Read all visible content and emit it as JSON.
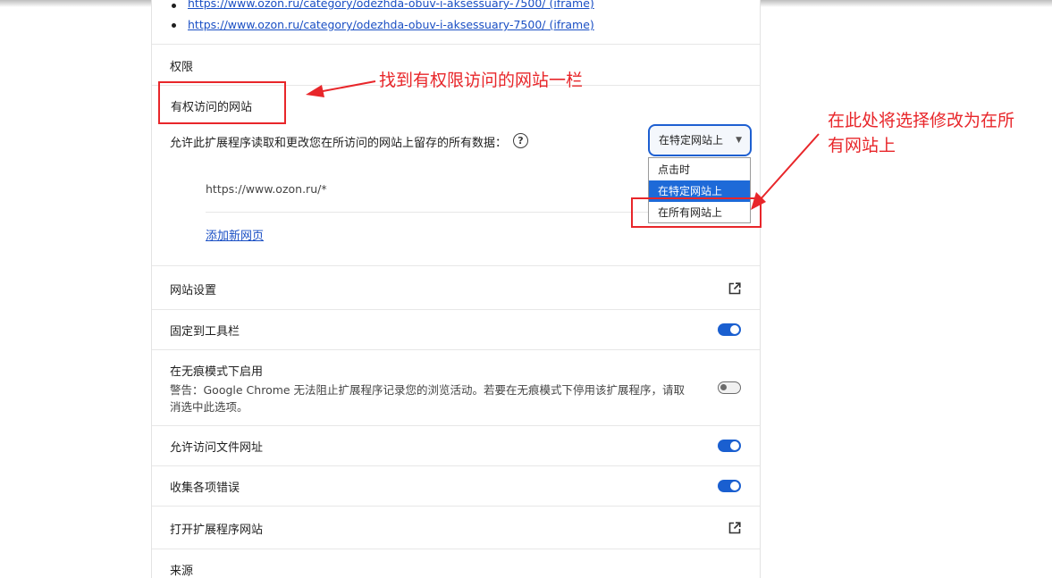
{
  "iframe_links": [
    "https://www.ozon.ru/category/odezhda-obuv-i-aksessuary-7500/ (iframe)",
    "https://www.ozon.ru/category/odezhda-obuv-i-aksessuary-7500/ (iframe)"
  ],
  "permissions": {
    "heading": "权限",
    "site_access_title": "有权访问的网站",
    "site_access_desc": "允许此扩展程序读取和更改您在所访问的网站上留存的所有数据：",
    "help_glyph": "?",
    "select_value": "在特定网站上",
    "options": [
      "点击时",
      "在特定网站上",
      "在所有网站上"
    ],
    "selected_option_index": 1,
    "site_url": "https://www.ozon.ru/*",
    "add_page_link": "添加新网页"
  },
  "settings": {
    "site_settings": "网站设置",
    "pin_toolbar": "固定到工具栏",
    "pin_toolbar_on": true,
    "incognito_title": "在无痕模式下启用",
    "incognito_warning_line1": "警告：Google Chrome 无法阻止扩展程序记录您的浏览活动。若要在无痕模式下停用该扩展程序，请取",
    "incognito_warning_line2": "消选中此选项。",
    "incognito_on": false,
    "file_urls": "允许访问文件网址",
    "file_urls_on": true,
    "collect_errors": "收集各项错误",
    "collect_errors_on": true,
    "open_website": "打开扩展程序网站",
    "source": "来源"
  },
  "annotations": {
    "note1": "找到有权限访问的网站一栏",
    "note2_line1": "在此处将选择修改为在所",
    "note2_line2": "有网站上",
    "color": "#e8262a"
  },
  "icons": {
    "external": "open-in-new-icon",
    "dropdown_caret": "caret-down-icon"
  }
}
